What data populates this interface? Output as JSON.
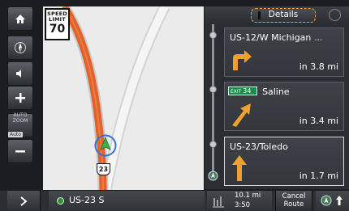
{
  "map": {
    "speed_limit_label": "SPEED LIMIT",
    "speed_limit_value": "70",
    "route_shield": "23"
  },
  "left_controls": {
    "auto_zoom_label": "AUTO ZOOM",
    "auto_zoom_tag": "Auto",
    "icons": [
      "home-icon",
      "compass-icon",
      "speaker-icon",
      "zoom-in-icon",
      "auto-zoom-icon",
      "zoom-out-icon"
    ]
  },
  "panel": {
    "details_label": "Details",
    "maneuvers": [
      {
        "road": "US-12/W Michigan ...",
        "distance": "in 3.8 mi",
        "icon": "turn-right-arrow-icon"
      },
      {
        "exit_prefix": "EXIT",
        "exit_number": "34",
        "road": "Saline",
        "distance": "in 3.4 mi",
        "icon": "slight-right-arrow-icon"
      },
      {
        "road": "US-23/Toledo",
        "distance": "in 1.7 mi",
        "icon": "straight-arrow-icon"
      }
    ]
  },
  "bottom_bar": {
    "current_road": "US-23 S",
    "trip_distance": "10.1 mi",
    "eta": "3:50",
    "cancel_route_line1": "Cancel",
    "cancel_route_line2": "Route"
  },
  "colors": {
    "route": "#e2622a",
    "accent_outline": "#f0a257",
    "exit_badge": "#1b8a4a",
    "maneuver_arrow": "#f0a030"
  }
}
